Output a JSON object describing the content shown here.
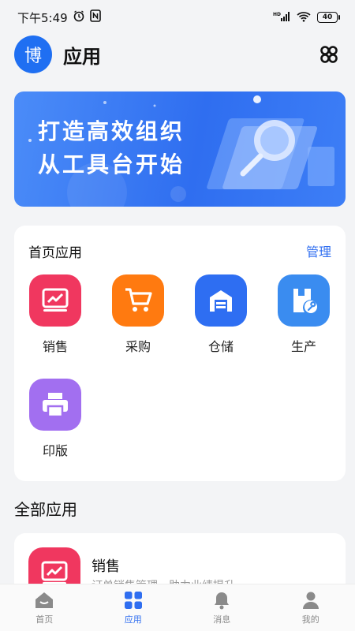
{
  "status": {
    "time": "下午5:49",
    "battery": "40",
    "network": "HD"
  },
  "header": {
    "avatar_text": "博",
    "title": "应用"
  },
  "banner": {
    "line1": "打造高效组织",
    "line2": "从工具台开始"
  },
  "home_apps": {
    "title": "首页应用",
    "manage_label": "管理",
    "items": [
      {
        "label": "销售",
        "color": "#f0375f",
        "icon": "chart-icon"
      },
      {
        "label": "采购",
        "color": "#ff7a10",
        "icon": "cart-icon"
      },
      {
        "label": "仓储",
        "color": "#2e6ef2",
        "icon": "warehouse-icon"
      },
      {
        "label": "生产",
        "color": "#3a8cf0",
        "icon": "production-icon"
      },
      {
        "label": "印版",
        "color": "#a26ff0",
        "icon": "printer-icon"
      }
    ]
  },
  "all_apps": {
    "title": "全部应用",
    "items": [
      {
        "name": "销售",
        "desc": "订单销售管理，助力业绩提升"
      }
    ]
  },
  "tabbar": {
    "items": [
      {
        "label": "首页",
        "icon": "home-icon"
      },
      {
        "label": "应用",
        "icon": "apps-icon",
        "active": true
      },
      {
        "label": "消息",
        "icon": "bell-icon"
      },
      {
        "label": "我的",
        "icon": "user-icon"
      }
    ]
  }
}
